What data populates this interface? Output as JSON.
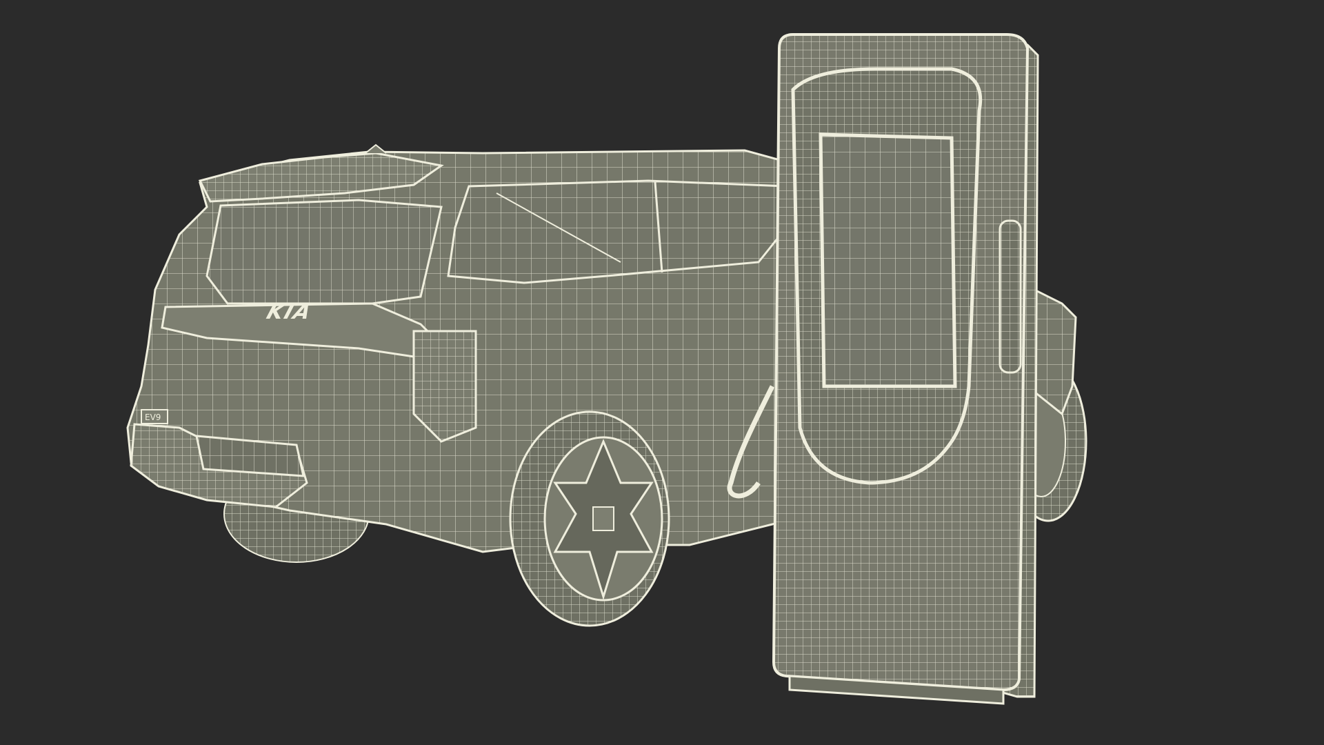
{
  "scene": {
    "background": "#2b2b2b",
    "surface_color": "#76786a",
    "wire_color": "#efeedd",
    "objects": [
      "suv",
      "ev-charger"
    ]
  },
  "vehicle": {
    "badge_text": "KIA",
    "model_text": "EV9"
  }
}
